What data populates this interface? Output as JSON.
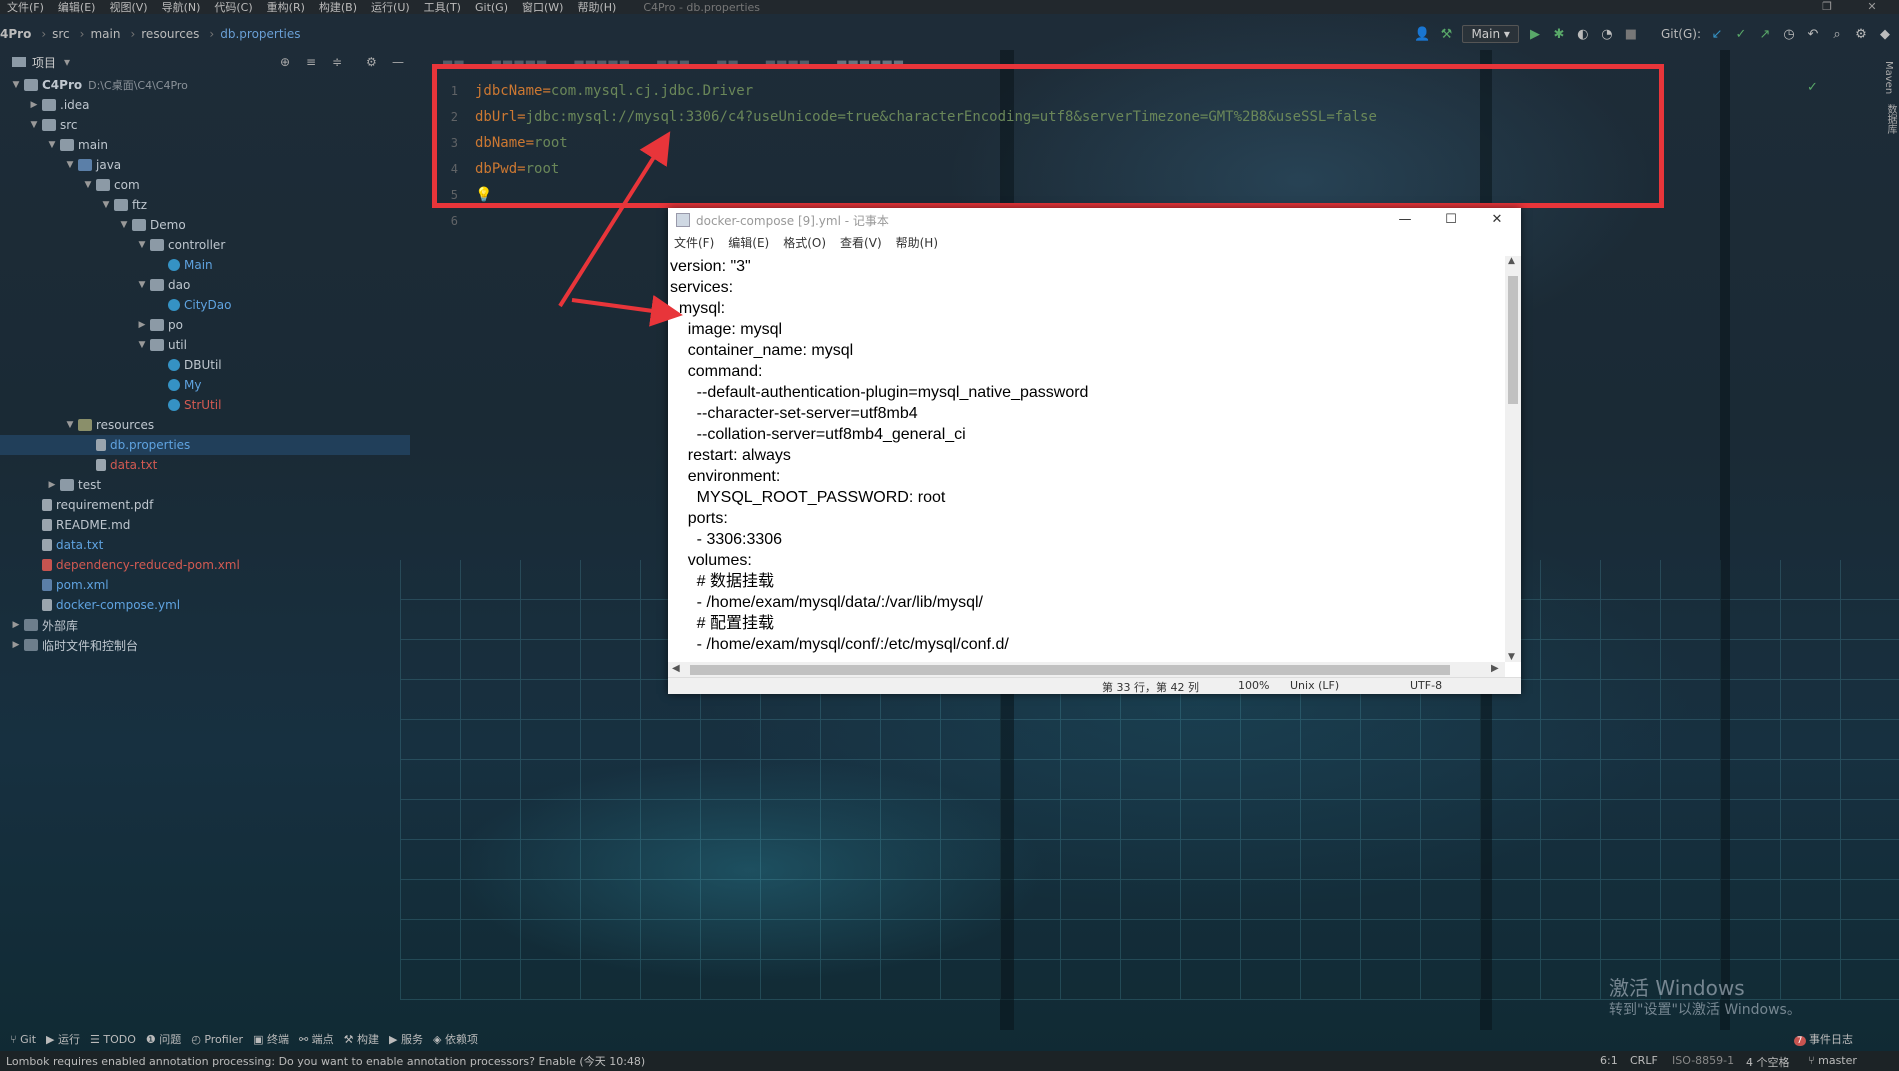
{
  "menubar": {
    "items": [
      "文件(F)",
      "编辑(E)",
      "视图(V)",
      "导航(N)",
      "代码(C)",
      "重构(R)",
      "构建(B)",
      "运行(U)",
      "工具(T)",
      "Git(G)",
      "窗口(W)",
      "帮助(H)"
    ],
    "title": "C4Pro - db.properties"
  },
  "breadcrumb": [
    "4Pro",
    "src",
    "main",
    "resources",
    "db.properties"
  ],
  "toolbar": {
    "run_config": "Main",
    "git_label": "Git(G):"
  },
  "project": {
    "header": "项目",
    "tree": [
      {
        "depth": 0,
        "arrow": "▼",
        "icon": "folder",
        "label": "C4Pro",
        "extra": "D:\\C桌面\\C4\\C4Pro",
        "color": "bold"
      },
      {
        "depth": 1,
        "arrow": "▶",
        "icon": "folder",
        "label": ".idea"
      },
      {
        "depth": 1,
        "arrow": "▼",
        "icon": "folder",
        "label": "src"
      },
      {
        "depth": 2,
        "arrow": "▼",
        "icon": "folder",
        "label": "main"
      },
      {
        "depth": 3,
        "arrow": "▼",
        "icon": "src",
        "label": "java"
      },
      {
        "depth": 4,
        "arrow": "▼",
        "icon": "folder",
        "label": "com"
      },
      {
        "depth": 5,
        "arrow": "▼",
        "icon": "folder",
        "label": "ftz"
      },
      {
        "depth": 6,
        "arrow": "▼",
        "icon": "folder",
        "label": "Demo"
      },
      {
        "depth": 7,
        "arrow": "▼",
        "icon": "folder",
        "label": "controller"
      },
      {
        "depth": 8,
        "arrow": "",
        "icon": "cls",
        "label": "Main",
        "color": "blue"
      },
      {
        "depth": 7,
        "arrow": "▼",
        "icon": "folder",
        "label": "dao"
      },
      {
        "depth": 8,
        "arrow": "",
        "icon": "cls",
        "label": "CityDao",
        "color": "blue"
      },
      {
        "depth": 7,
        "arrow": "▶",
        "icon": "folder",
        "label": "po"
      },
      {
        "depth": 7,
        "arrow": "▼",
        "icon": "folder",
        "label": "util"
      },
      {
        "depth": 8,
        "arrow": "",
        "icon": "cls",
        "label": "DBUtil"
      },
      {
        "depth": 8,
        "arrow": "",
        "icon": "cls",
        "label": "My",
        "color": "blue"
      },
      {
        "depth": 8,
        "arrow": "",
        "icon": "cls",
        "label": "StrUtil",
        "color": "red"
      },
      {
        "depth": 3,
        "arrow": "▼",
        "icon": "res",
        "label": "resources"
      },
      {
        "depth": 4,
        "arrow": "",
        "icon": "file",
        "label": "db.properties",
        "color": "blue",
        "selected": true
      },
      {
        "depth": 4,
        "arrow": "",
        "icon": "file",
        "label": "data.txt",
        "color": "red"
      },
      {
        "depth": 2,
        "arrow": "▶",
        "icon": "folder",
        "label": "test"
      },
      {
        "depth": 1,
        "arrow": "",
        "icon": "file",
        "label": "requirement.pdf"
      },
      {
        "depth": 1,
        "arrow": "",
        "icon": "file",
        "label": "README.md"
      },
      {
        "depth": 1,
        "arrow": "",
        "icon": "file",
        "label": "data.txt",
        "color": "blue"
      },
      {
        "depth": 1,
        "arrow": "",
        "icon": "xml",
        "label": "dependency-reduced-pom.xml",
        "color": "red"
      },
      {
        "depth": 1,
        "arrow": "",
        "icon": "pom",
        "label": "pom.xml",
        "color": "blue"
      },
      {
        "depth": 1,
        "arrow": "",
        "icon": "file",
        "label": "docker-compose.yml",
        "color": "blue"
      },
      {
        "depth": 0,
        "arrow": "▶",
        "icon": "lib",
        "label": "外部库"
      },
      {
        "depth": 0,
        "arrow": "▶",
        "icon": "lib",
        "label": "临时文件和控制台"
      }
    ]
  },
  "editor": {
    "line_numbers": [
      "1",
      "2",
      "3",
      "4",
      "5",
      "6"
    ],
    "lines": [
      {
        "key": "jdbcName",
        "value": "com.mysql.cj.jdbc.Driver"
      },
      {
        "key": "dbUrl",
        "value": "jdbc:mysql://mysql:3306/c4?useUnicode=true&characterEncoding=utf8&serverTimezone=GMT%2B8&useSSL=false"
      },
      {
        "key": "dbName",
        "value": "root"
      },
      {
        "key": "dbPwd",
        "value": "root"
      }
    ],
    "eq": "="
  },
  "notepad": {
    "title": "docker-compose [9].yml - 记事本",
    "menu": [
      "文件(F)",
      "编辑(E)",
      "格式(O)",
      "查看(V)",
      "帮助(H)"
    ],
    "lines": [
      "version: \"3\"",
      "services:",
      "  mysql:",
      "    image: mysql",
      "    container_name: mysql",
      "    command:",
      "      --default-authentication-plugin=mysql_native_password",
      "      --character-set-server=utf8mb4",
      "      --collation-server=utf8mb4_general_ci",
      "    restart: always",
      "    environment:",
      "      MYSQL_ROOT_PASSWORD: root",
      "    ports:",
      "      - 3306:3306",
      "    volumes:",
      "      # 数据挂载",
      "      - /home/exam/mysql/data/:/var/lib/mysql/",
      "      # 配置挂载",
      "      - /home/exam/mysql/conf/:/etc/mysql/conf.d/"
    ],
    "status": {
      "position": "第 33 行，第 42 列",
      "zoom": "100%",
      "eol": "Unix (LF)",
      "encoding": "UTF-8"
    }
  },
  "watermark": {
    "line1": "激活 Windows",
    "line2": "转到\"设置\"以激活 Windows。"
  },
  "toolwindows": [
    "Git",
    "运行",
    "TODO",
    "问题",
    "Profiler",
    "终端",
    "端点",
    "构建",
    "服务",
    "依赖项"
  ],
  "event_log": "事件日志",
  "event_count": "7",
  "statusbar": {
    "message": "Lombok requires enabled annotation processing: Do you want to enable annotation processors? Enable (今天 10:48)",
    "position": "6:1",
    "eol": "CRLF",
    "encoding": "ISO-8859-1",
    "indent": "4 个空格",
    "branch": "master"
  },
  "right_strip": [
    "Maven",
    "数据库"
  ]
}
